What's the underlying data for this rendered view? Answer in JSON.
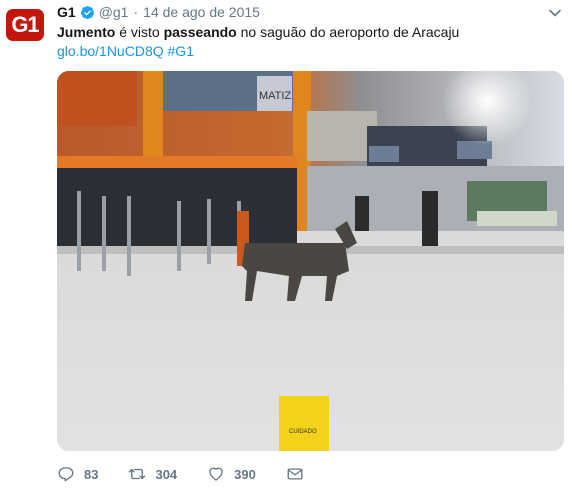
{
  "tweet": {
    "avatar_text": "G1",
    "name": "G1",
    "handle": "@g1",
    "separator": "·",
    "date": "14 de ago de 2015",
    "text": {
      "word1": "Jumento",
      "part2": " é visto ",
      "word2": "passeando",
      "part3": " no saguão do aeroporto de Aracaju"
    },
    "link": "glo.bo/1NuCD8Q",
    "hashtag": "#G1",
    "media": {
      "sign_text_1": "MATIZ",
      "wet_floor_text": "CUIDADO"
    },
    "actions": {
      "reply_count": "83",
      "retweet_count": "304",
      "like_count": "390"
    }
  },
  "colors": {
    "brand": "#c4170c",
    "link": "#1b95e0",
    "muted": "#657786",
    "verified": "#1da1f2"
  }
}
